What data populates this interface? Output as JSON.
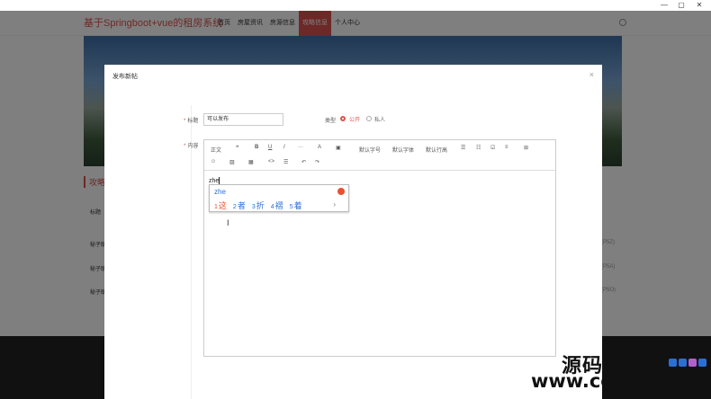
{
  "window": {
    "minimize": "—",
    "maximize": "▢",
    "close": "✕"
  },
  "site": {
    "title": "基于Springboot+vue的租房系统",
    "nav": [
      "首页",
      "房屋资讯",
      "房源信息",
      "攻略信息",
      "个人中心"
    ],
    "active_nav_index": 3
  },
  "page": {
    "section_title": "攻略",
    "filter_label": "标题",
    "rows": [
      {
        "label": "秘子联",
        "right": "(P5Z)"
      },
      {
        "label": "秘子联",
        "right": "(P5A)"
      },
      {
        "label": "秘子联",
        "right": "(P5O)"
      }
    ]
  },
  "dialog": {
    "title": "发布新帖",
    "close": "×",
    "title_label": "标题",
    "title_value": "可以发布",
    "type_label": "类型",
    "type_options": [
      {
        "label": "公开",
        "selected": true
      },
      {
        "label": "私人",
        "selected": false
      }
    ],
    "content_label": "内容"
  },
  "editor": {
    "toolbar_row1": [
      "正文",
      "❝",
      "B",
      "U",
      "I",
      "···",
      "A",
      "▣",
      "默认字号",
      "默认字体",
      "默认行高",
      "☰",
      "☷",
      "☑",
      "≡",
      "⊞"
    ],
    "toolbar_row2": [
      "☺",
      "▨",
      "▦",
      "<>",
      "☰",
      "↶",
      "↷"
    ],
    "typed_text": "zhe"
  },
  "ime": {
    "pinyin": "zhe",
    "candidates": [
      {
        "num": "1",
        "char": "这"
      },
      {
        "num": "2",
        "char": "者"
      },
      {
        "num": "3",
        "char": "折"
      },
      {
        "num": "4",
        "char": "褶"
      },
      {
        "num": "5",
        "char": "着"
      }
    ],
    "more": "›"
  },
  "watermark": {
    "line1": "源码海洋网",
    "line2": "www.codehy.com"
  },
  "cursor": "I"
}
